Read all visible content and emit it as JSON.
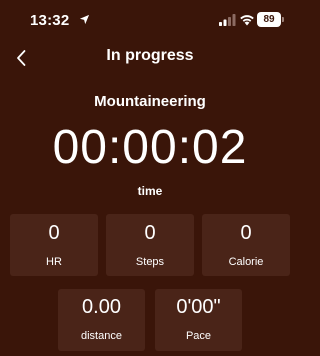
{
  "status_bar": {
    "time": "13:32",
    "battery": "89",
    "location_icon": "location-arrow-icon",
    "signal_icon": "cellular-signal-icon",
    "wifi_icon": "wifi-icon"
  },
  "header": {
    "title": "In progress",
    "back_icon": "chevron-left-icon"
  },
  "workout": {
    "activity": "Mountaineering",
    "timer": "00:00:02",
    "timer_label": "time"
  },
  "metrics": [
    {
      "value": "0",
      "label": "HR"
    },
    {
      "value": "0",
      "label": "Steps"
    },
    {
      "value": "0",
      "label": "Calorie"
    },
    {
      "value": "0.00",
      "label": "distance"
    },
    {
      "value": "0'00\"",
      "label": "Pace"
    }
  ],
  "colors": {
    "background": "#3a1509",
    "tile": "#4a2418",
    "text": "#ffffff"
  }
}
